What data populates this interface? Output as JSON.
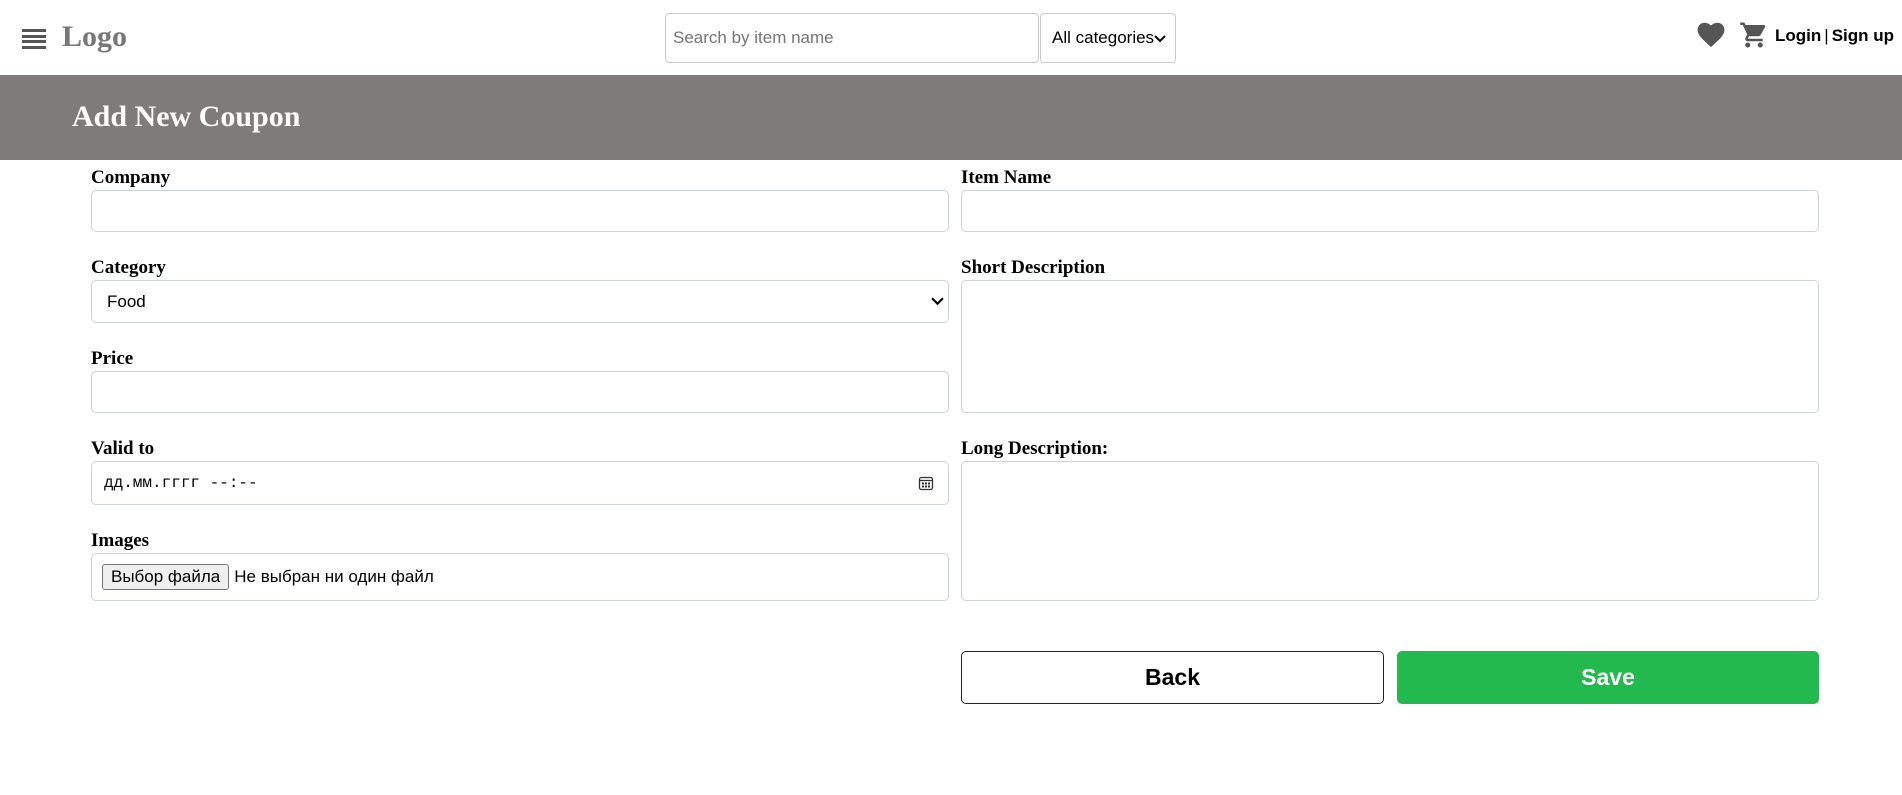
{
  "header": {
    "menu_icon": "hamburger-menu-icon",
    "logo": "Logo",
    "search": {
      "placeholder": "Search by item name",
      "value": ""
    },
    "category_filter": {
      "selected": "All categories"
    },
    "favorites_icon": "heart-icon",
    "cart_icon": "shopping-cart-icon",
    "login_label": "Login",
    "separator": "|",
    "signup_label": "Sign up"
  },
  "page": {
    "title": "Add New Coupon"
  },
  "form": {
    "company": {
      "label": "Company",
      "value": ""
    },
    "category": {
      "label": "Category",
      "selected": "Food"
    },
    "price": {
      "label": "Price",
      "value": ""
    },
    "valid_to": {
      "label": "Valid to",
      "value": "дд.мм.гггг --:--",
      "icon": "calendar-icon"
    },
    "images": {
      "label": "Images",
      "button_label": "Выбор файла",
      "status": "Не выбран ни один файл"
    },
    "item_name": {
      "label": "Item Name",
      "value": ""
    },
    "short_description": {
      "label": "Short Description",
      "value": ""
    },
    "long_description": {
      "label": "Long Description:",
      "value": ""
    },
    "back_label": "Back",
    "save_label": "Save"
  },
  "colors": {
    "banner_bg": "#7f7b7a",
    "save_button": "#24b94f",
    "logo_text": "#777777",
    "icon_gray": "#555555"
  }
}
